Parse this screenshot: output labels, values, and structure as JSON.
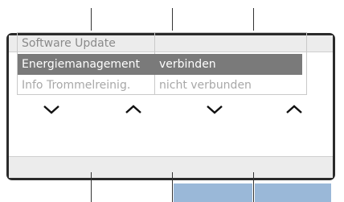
{
  "list": {
    "rows": [
      {
        "label": "Software Update",
        "value": ""
      },
      {
        "label": "Energiemanagement",
        "value": "verbinden"
      },
      {
        "label": "Info Trommelreinig.",
        "value": "nicht verbunden"
      }
    ]
  },
  "nav": {
    "buttons": [
      "down-icon",
      "up-icon",
      "down-icon",
      "up-icon"
    ]
  },
  "colors": {
    "selected_row": "#7a7a7a",
    "active_tab": "#9ab8d8"
  }
}
